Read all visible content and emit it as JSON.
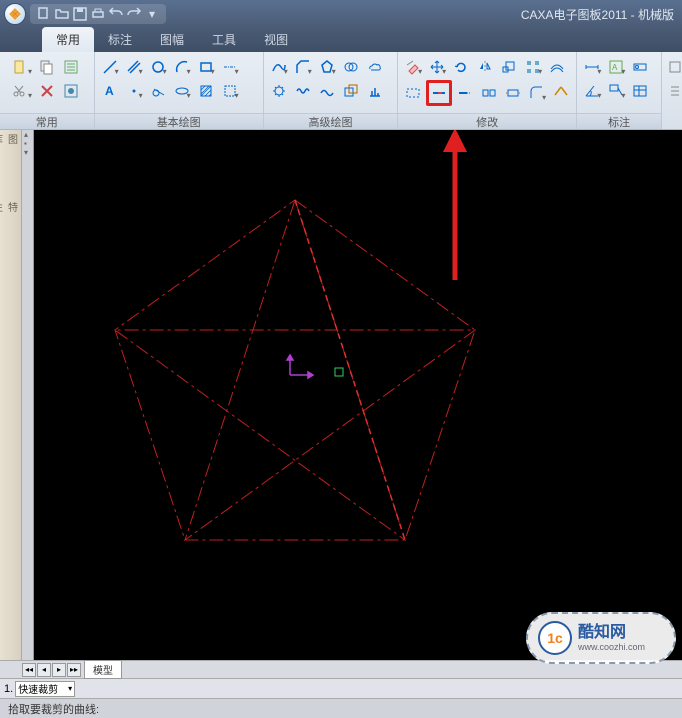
{
  "title": "CAXA电子图板2011 - 机械版",
  "tabs": [
    "常用",
    "标注",
    "图幅",
    "工具",
    "视图"
  ],
  "ribbon_groups": {
    "g1": "常用",
    "g2": "基本绘图",
    "g3": "高级绘图",
    "g4": "修改",
    "g5": "标注"
  },
  "sheet_tab": "模型",
  "input_mode": "快速裁剪",
  "input_prefix": "1.",
  "status": "拾取要裁剪的曲线:",
  "left_labels": {
    "a": "图库",
    "b": "特性"
  },
  "watermark": {
    "logo": "1c",
    "brand": "酷知网",
    "url": "www.coozhi.com"
  }
}
